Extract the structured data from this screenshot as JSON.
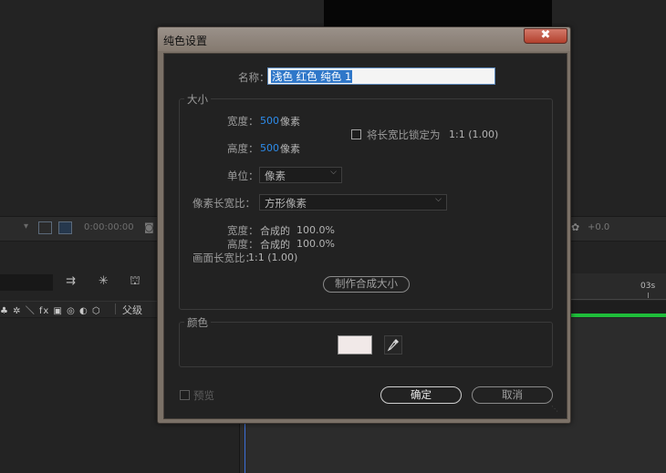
{
  "background": {
    "timecode": "0:00:00:00",
    "right_value": "+0.0",
    "ruler_label": "03s",
    "parent_label": "父级",
    "switch_icons": "♣ ✲ ＼ fx ▣ ◎ ◐ ⬡",
    "icons": {
      "cam": "camera-icon",
      "settings": "gear-icon"
    },
    "accent_green": "#1fbe3a",
    "playhead_color": "#3b6fd8"
  },
  "dialog": {
    "title": "纯色设置",
    "close_glyph": "✖",
    "name_label": "名称：",
    "name_value": "浅色 红色 纯色 1",
    "size_group": {
      "label": "大小",
      "width_label": "宽度：",
      "width_value": "500",
      "width_unit": "像素",
      "height_label": "高度：",
      "height_value": "500",
      "height_unit": "像素",
      "lock_label": "将长宽比锁定为",
      "lock_ratio": "1:1 (1.00)",
      "lock_checked": false,
      "unit_label": "单位：",
      "unit_value": "像素",
      "pixel_aspect_label": "像素长宽比：",
      "pixel_aspect_value": "方形像素",
      "comp_width_label": "宽度：",
      "comp_width_value": "合成的",
      "comp_width_pct": "100.0%",
      "comp_height_label": "高度：",
      "comp_height_value": "合成的",
      "comp_height_pct": "100.0%",
      "frame_aspect_label": "画面长宽比：",
      "frame_aspect_value": "1:1 (1.00)",
      "make_comp_size": "制作合成大小"
    },
    "color_group": {
      "label": "颜色",
      "swatch_color": "#f1e9e8"
    },
    "preview_label": "预览",
    "preview_checked": false,
    "ok_label": "确定",
    "cancel_label": "取消"
  }
}
